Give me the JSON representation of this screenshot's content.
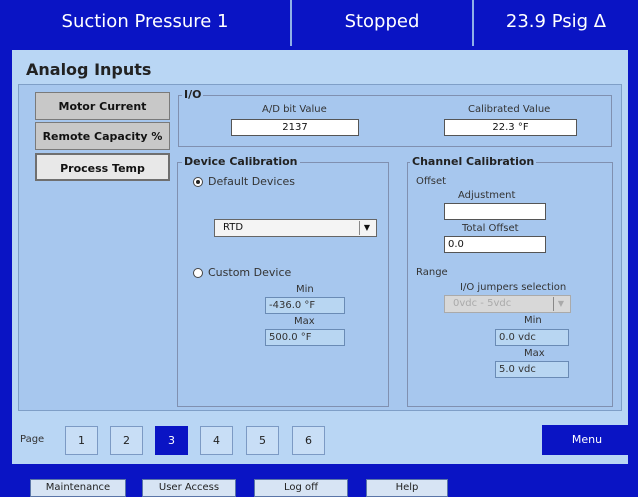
{
  "header": {
    "title": "Suction Pressure 1",
    "status": "Stopped",
    "reading": "23.9 Psig Δ"
  },
  "panel": {
    "title": "Analog Inputs",
    "tabs": [
      {
        "label": "Motor Current"
      },
      {
        "label": "Remote Capacity %"
      },
      {
        "label": "Process Temp"
      }
    ]
  },
  "io": {
    "title": "I/O",
    "ad_label": "A/D bit Value",
    "ad_value": "2137",
    "cal_label": "Calibrated Value",
    "cal_value": "22.3 °F"
  },
  "device_cal": {
    "title": "Device Calibration",
    "default_label": "Default Devices",
    "dropdown_value": "RTD",
    "custom_label": "Custom Device",
    "min_label": "Min",
    "min_value": "-436.0 °F",
    "max_label": "Max",
    "max_value": "500.0 °F"
  },
  "channel_cal": {
    "title": "Channel Calibration",
    "offset_label": "Offset",
    "adjustment_label": "Adjustment",
    "adjustment_value": "",
    "total_offset_label": "Total Offset",
    "total_offset_value": "0.0",
    "range_label": "Range",
    "jumpers_label": "I/O jumpers selection",
    "jumpers_value": "0vdc - 5vdc",
    "min_label": "Min",
    "min_value": "0.0 vdc",
    "max_label": "Max",
    "max_value": "5.0 vdc"
  },
  "pager": {
    "label": "Page",
    "pages": [
      "1",
      "2",
      "3",
      "4",
      "5",
      "6"
    ],
    "current": "3",
    "menu_label": "Menu"
  },
  "footer": {
    "buttons": [
      {
        "label": "Maintenance"
      },
      {
        "label": "User Access"
      },
      {
        "label": "Log off"
      },
      {
        "label": "Help"
      }
    ]
  },
  "colors": {
    "header_bg": "#0a14c4",
    "panel_bg": "#b9d6f4",
    "active_page": "#0a14c4"
  }
}
